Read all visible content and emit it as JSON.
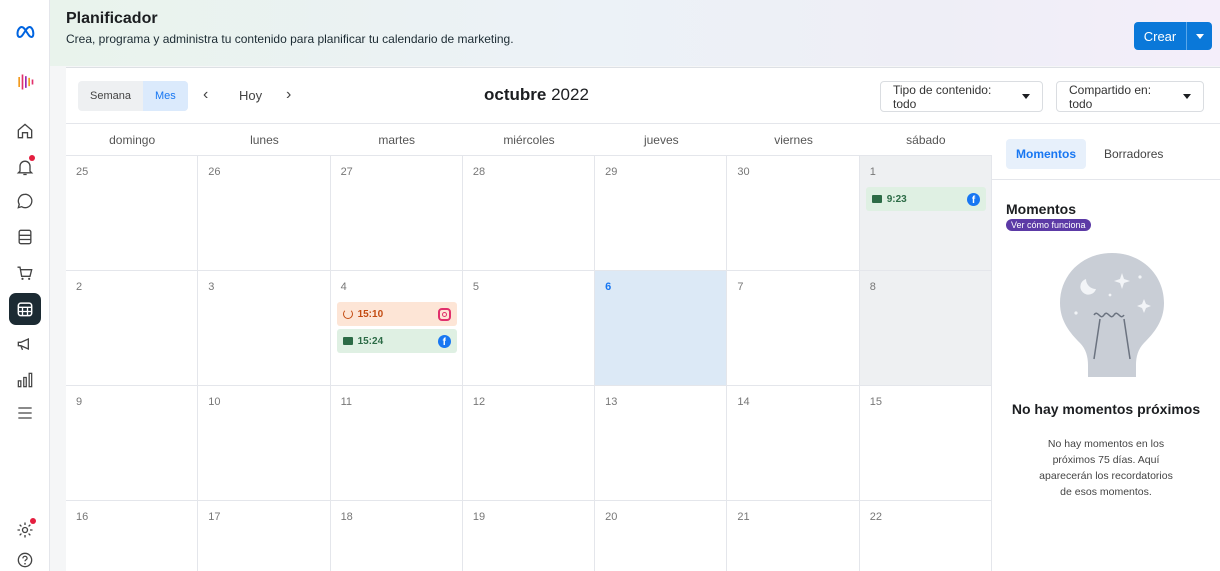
{
  "header": {
    "title": "Planificador",
    "subtitle": "Crea, programa y administra tu contenido para planificar tu calendario de marketing.",
    "create_label": "Crear"
  },
  "rail": {
    "items": [
      "meta-logo",
      "brand-avatar",
      "home",
      "notifications",
      "messages",
      "content",
      "commerce",
      "planner",
      "ads",
      "insights",
      "menu",
      "settings",
      "help"
    ]
  },
  "toolbar": {
    "view_week": "Semana",
    "view_month": "Mes",
    "today": "Hoy",
    "month_name": "octubre",
    "year": "2022",
    "filter_type": "Tipo de contenido: todo",
    "filter_shared": "Compartido en: todo"
  },
  "calendar": {
    "weekdays": [
      "domingo",
      "lunes",
      "martes",
      "miércoles",
      "jueves",
      "viernes",
      "sábado"
    ],
    "weeks": [
      [
        "25",
        "26",
        "27",
        "28",
        "29",
        "30",
        "1"
      ],
      [
        "2",
        "3",
        "4",
        "5",
        "6",
        "7",
        "8"
      ],
      [
        "9",
        "10",
        "11",
        "12",
        "13",
        "14",
        "15"
      ],
      [
        "16",
        "17",
        "18",
        "19",
        "20",
        "21",
        "22"
      ]
    ],
    "events": {
      "oct1": {
        "time": "9:23",
        "status": "scheduled",
        "network": "facebook"
      },
      "oct4_a": {
        "time": "15:10",
        "status": "pending",
        "network": "instagram"
      },
      "oct4_b": {
        "time": "15:24",
        "status": "scheduled",
        "network": "facebook"
      }
    },
    "fb_glyph": "f"
  },
  "panel": {
    "tab_moments": "Momentos",
    "tab_drafts": "Borradores",
    "section_title": "Momentos",
    "howto_label": "Ver cómo funciona",
    "empty_title": "No hay momentos próximos",
    "empty_text": "No hay momentos en los próximos 75 días. Aquí aparecerán los recordatorios de esos momentos."
  },
  "colors": {
    "accent": "#1877f2",
    "create": "#0a78d9",
    "scheduled": "#dff0e3",
    "pending": "#fde5d6",
    "howto": "#5c3aa6"
  }
}
